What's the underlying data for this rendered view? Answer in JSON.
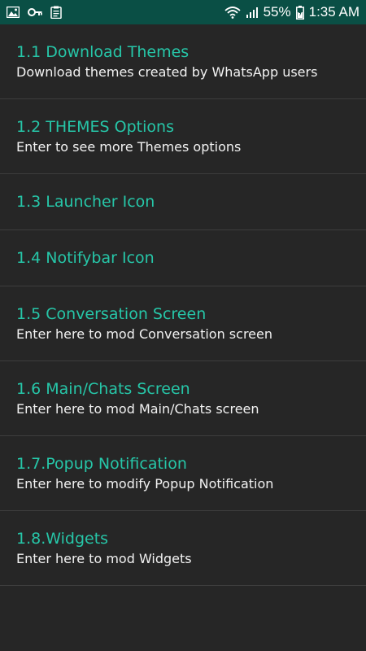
{
  "status_bar": {
    "battery_percent": "55%",
    "time": "1:35 AM",
    "icons": [
      "image-icon",
      "key-icon",
      "clipboard-icon",
      "wifi-icon",
      "signal-icon",
      "battery-icon"
    ]
  },
  "colors": {
    "status_bar_bg": "#0a4f45",
    "background": "#262626",
    "title_accent": "#26c6a8",
    "subtitle_text": "#f2f2f2",
    "divider": "#3d3d3d"
  },
  "menu": {
    "items": [
      {
        "title": "1.1 Download Themes",
        "subtitle": "Download themes created by WhatsApp users"
      },
      {
        "title": "1.2 THEMES Options",
        "subtitle": "Enter to see more Themes options"
      },
      {
        "title": "1.3 Launcher Icon"
      },
      {
        "title": "1.4 Notifybar Icon"
      },
      {
        "title": "1.5 Conversation Screen",
        "subtitle": "Enter here to mod Conversation screen"
      },
      {
        "title": "1.6 Main/Chats Screen",
        "subtitle": "Enter here to mod Main/Chats screen"
      },
      {
        "title": "1.7.Popup Notification",
        "subtitle": "Enter here to modify Popup Notification"
      },
      {
        "title": "1.8.Widgets",
        "subtitle": "Enter here to mod Widgets"
      }
    ]
  }
}
